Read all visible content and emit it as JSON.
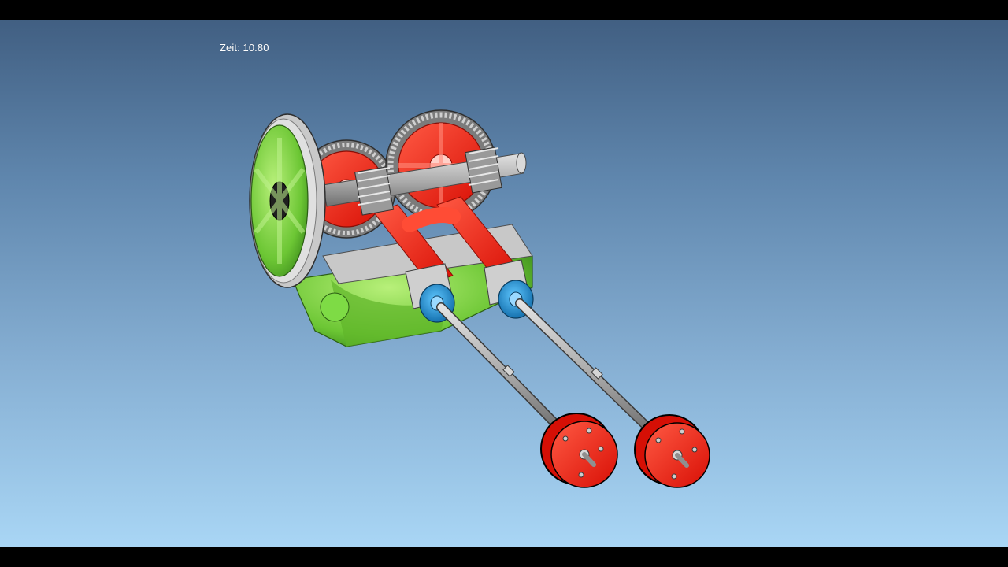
{
  "simulation": {
    "time_label": "Zeit: 10.80"
  },
  "colors": {
    "background_top": "#415f82",
    "background_bottom": "#a9d6f5",
    "housing": "#6fcf3a",
    "flywheel": "#8fd65a",
    "crank_parts": "#ff2a1a",
    "gear_teeth": "#8a8a8a",
    "shaft": "#b4b4b4",
    "bearing_collar": "#1a86c8",
    "wheel_discs": "#ff2a1a"
  },
  "icons": [
    "3d-mechanism-model"
  ]
}
